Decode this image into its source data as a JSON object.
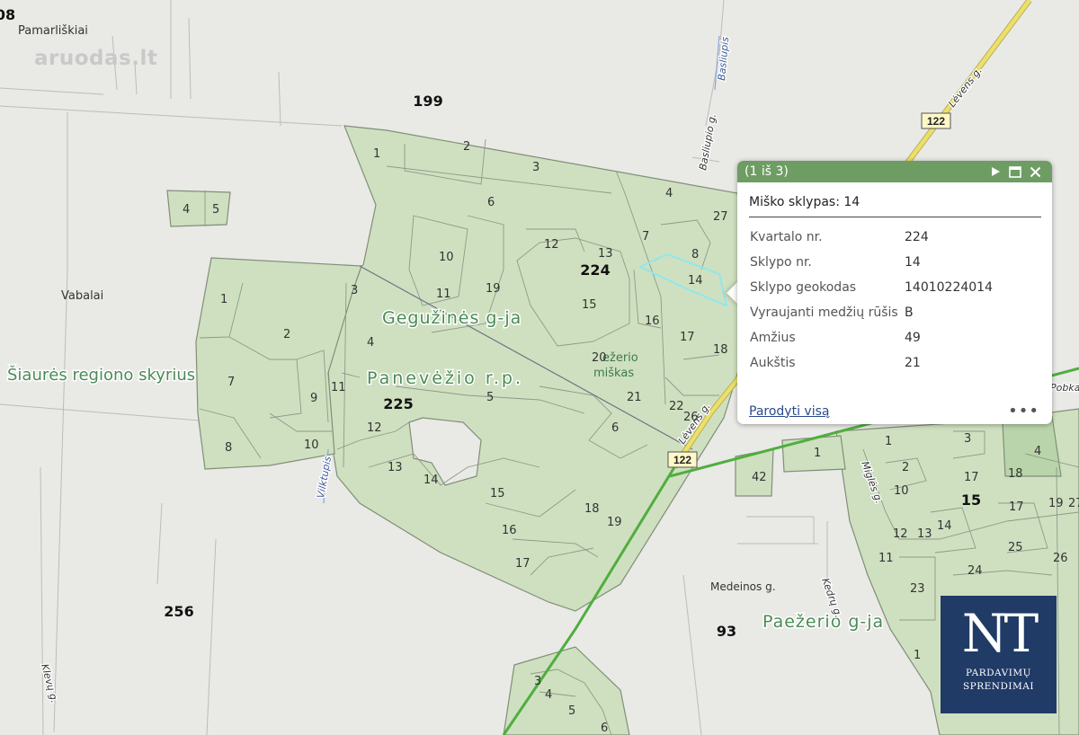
{
  "map": {
    "quarters": [
      "199",
      "224",
      "225",
      "256",
      "93",
      "15",
      "08"
    ],
    "places": [
      "Pamarliškiai",
      "Vabalai",
      "Šiaurės regiono skyrius",
      "Medeinos g."
    ],
    "regions": [
      "Gegužinės g-ja",
      "Panevėžio r.p.",
      "Paežerio g-ja"
    ],
    "forest_label": [
      "ežerio",
      "miškas"
    ],
    "streets": [
      "Basliupio g.",
      "Basliupis",
      "Lėvens g.",
      "Vilktupis",
      "Kedrų g.",
      "Klevų g.",
      "Miglės g.",
      "Pobka"
    ],
    "road_number": "122",
    "parcels_left": [
      "1",
      "2",
      "3",
      "4",
      "5",
      "6",
      "7",
      "8",
      "9",
      "10",
      "11",
      "12",
      "13",
      "14",
      "15",
      "16",
      "17",
      "18",
      "19",
      "20",
      "21",
      "22",
      "26",
      "4",
      "5",
      "3",
      "2",
      "1",
      "6"
    ],
    "parcels_right": [
      "1",
      "2",
      "3",
      "4",
      "10",
      "11",
      "12",
      "13",
      "14",
      "15",
      "16",
      "17",
      "18",
      "19",
      "23",
      "24",
      "25",
      "26",
      "27",
      "42",
      "1"
    ],
    "colors": {
      "parcel_fill": "#cfe0c0",
      "parcel_stroke": "#7f8f78",
      "road": "#ecdf6a",
      "green_line": "#4fae3e",
      "selection": "#8ee7ee"
    }
  },
  "popup": {
    "counter": "(1 iš 3)",
    "icons": [
      "play-icon",
      "maximize-icon",
      "close-icon"
    ],
    "title": "Miško sklypas: 14",
    "rows": [
      {
        "label": "Kvartalo nr.",
        "value": "224"
      },
      {
        "label": "Sklypo nr.",
        "value": "14"
      },
      {
        "label": "Sklypo geokodas",
        "value": "14010224014"
      },
      {
        "label": "Vyraujanti medžių rūšis",
        "value": "B"
      },
      {
        "label": "Amžius",
        "value": "49"
      },
      {
        "label": "Aukštis",
        "value": "21"
      }
    ],
    "show_all": "Parodyti visą",
    "more": "•••"
  },
  "watermark": "aruodas.lt",
  "logo": {
    "mark": "NT",
    "line1": "PARDAVIMŲ",
    "line2": "SPRENDIMAI"
  }
}
